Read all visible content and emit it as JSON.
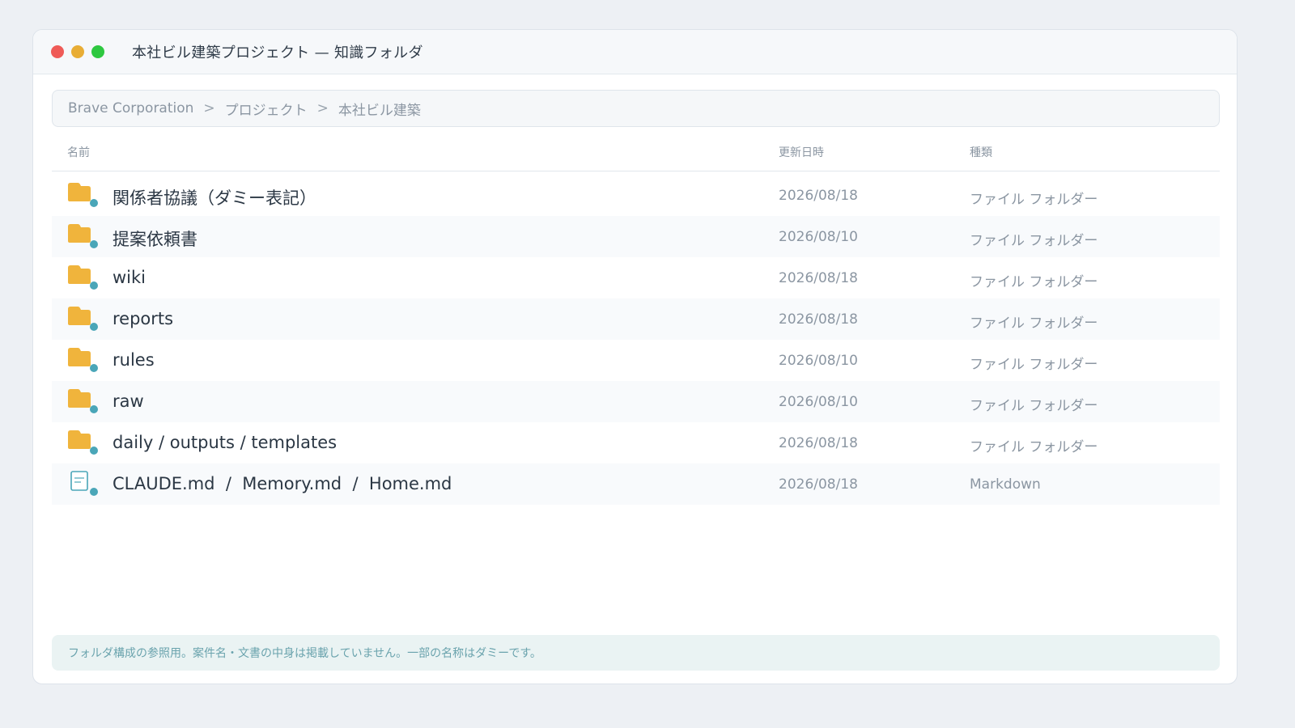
{
  "window": {
    "title": "本社ビル建築プロジェクト — 知識フォルダ",
    "controls": {
      "close_color": "#ef5b57",
      "minimize_color": "#e8ad35",
      "zoom_color": "#2ec840"
    }
  },
  "breadcrumb": {
    "items": [
      "Brave Corporation",
      "プロジェクト",
      "本社ビル建築"
    ],
    "separator": ">"
  },
  "columns": {
    "name": "名前",
    "modified": "更新日時",
    "kind": "種類"
  },
  "rows": [
    {
      "icon": "folder-icon",
      "name": "関係者協議（ダミー表記）",
      "modified": "2026/08/18",
      "kind": "ファイル フォルダー"
    },
    {
      "icon": "folder-icon",
      "name": "提案依頼書",
      "modified": "2026/08/10",
      "kind": "ファイル フォルダー"
    },
    {
      "icon": "folder-icon",
      "name": "wiki",
      "modified": "2026/08/18",
      "kind": "ファイル フォルダー"
    },
    {
      "icon": "folder-icon",
      "name": "reports",
      "modified": "2026/08/18",
      "kind": "ファイル フォルダー"
    },
    {
      "icon": "folder-icon",
      "name": "rules",
      "modified": "2026/08/10",
      "kind": "ファイル フォルダー"
    },
    {
      "icon": "folder-icon",
      "name": "raw",
      "modified": "2026/08/10",
      "kind": "ファイル フォルダー"
    },
    {
      "icon": "folder-icon",
      "name": "daily / outputs / templates",
      "modified": "2026/08/18",
      "kind": "ファイル フォルダー"
    },
    {
      "icon": "document-icon",
      "name": "CLAUDE.md  /  Memory.md  /  Home.md",
      "modified": "2026/08/18",
      "kind": "Markdown"
    }
  ],
  "footnote": "フォルダ構成の参照用。案件名・文書の中身は掲載していません。一部の名称はダミーです。",
  "colors": {
    "folder": "#f0b43c",
    "status_dot": "#4aa6b8",
    "document_outline": "#4aa6b8"
  }
}
